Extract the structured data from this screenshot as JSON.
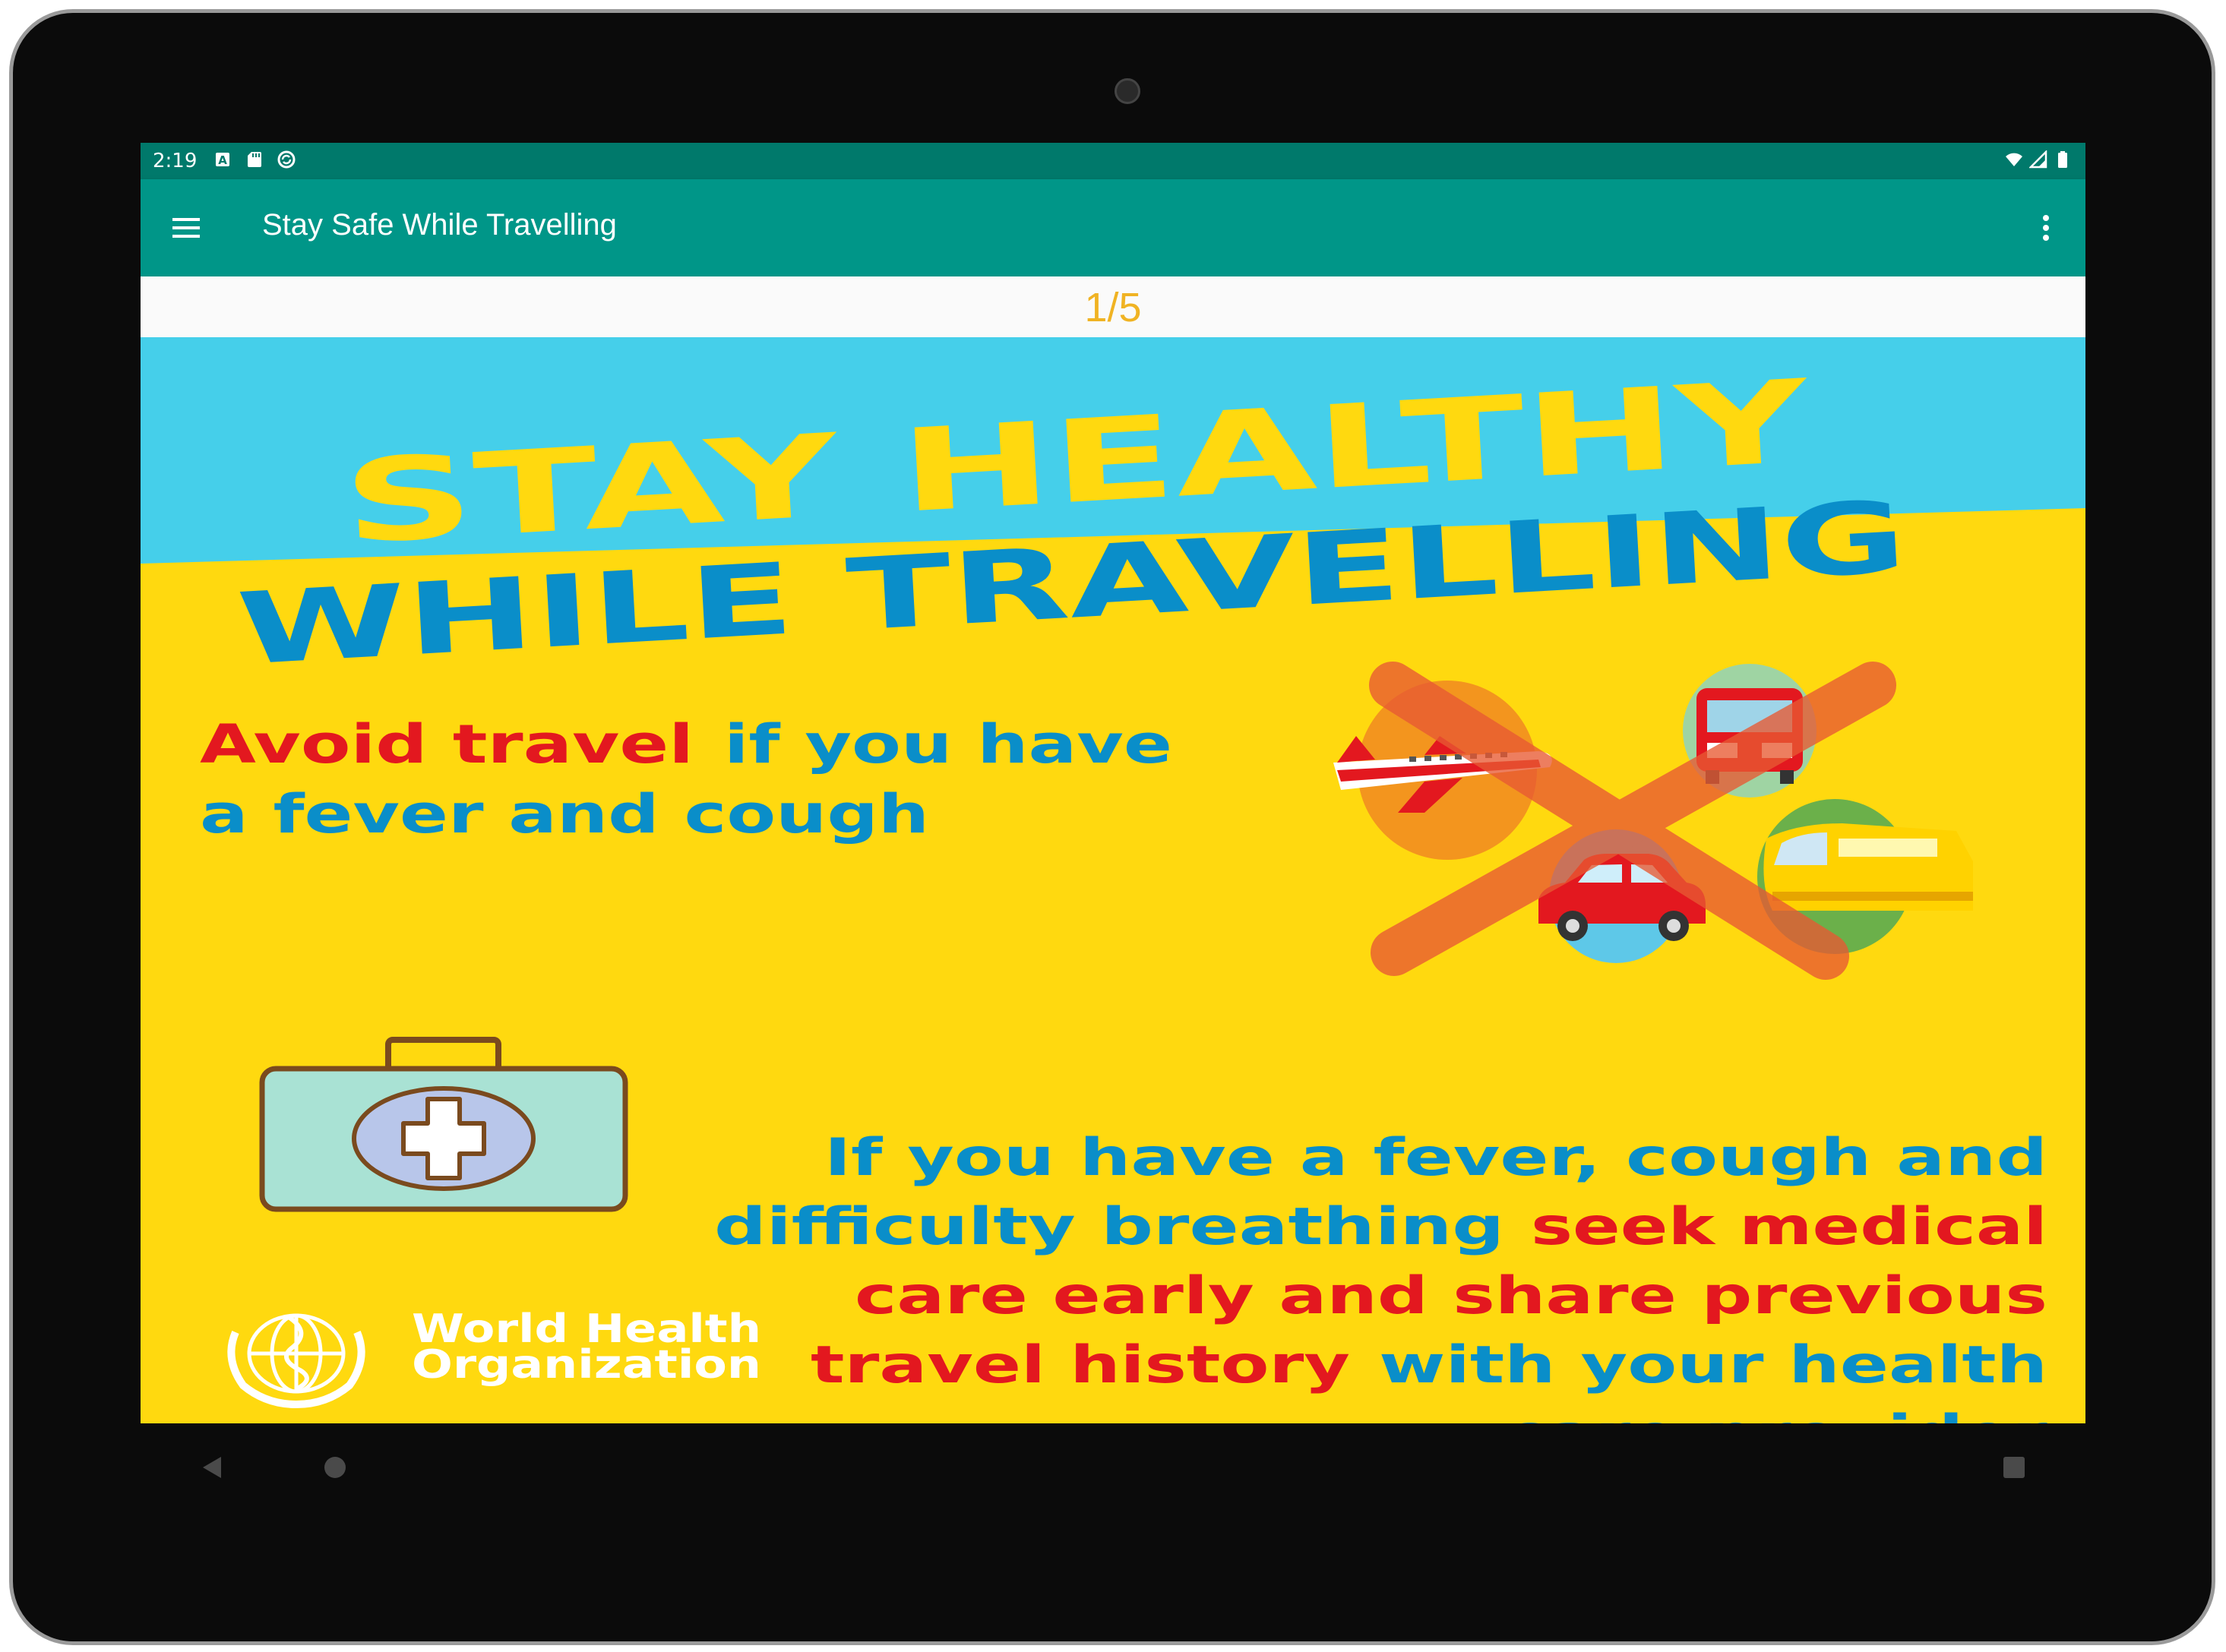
{
  "status_bar": {
    "time": "2:19",
    "left_icons": [
      "a-notification-icon",
      "sd-card-icon",
      "sync-circle-icon"
    ],
    "right_icons": [
      "wifi-icon",
      "cell-signal-icon",
      "battery-icon"
    ]
  },
  "app_bar": {
    "title": "Stay Safe While Travelling",
    "menu_icon": "hamburger-menu-icon",
    "overflow_icon": "more-vert-icon",
    "background": "#009688",
    "status_background": "#00796b"
  },
  "pager": {
    "indicator": "1/5",
    "color": "#f0b323"
  },
  "poster": {
    "headline_1": "STAY HEALTHY",
    "headline_2": "WHILE TRAVELLING",
    "avoid_red": "Avoid travel",
    "avoid_blue_1": "if you have",
    "avoid_blue_2": "a fever and cough",
    "seek_line_1": "If you have a fever, cough and",
    "seek_line_2_blue": "difficulty breathing",
    "seek_line_2_red": "seek medical",
    "seek_line_3": "care early and share previous",
    "seek_line_4_red": "travel history",
    "seek_line_4_blue": "with your health",
    "seek_line_5": "care provider",
    "org_line_1": "World Health",
    "org_line_2": "Organization",
    "colors": {
      "yellow": "#ffd90f",
      "cyan": "#45cfea",
      "blue": "#0a8ec9",
      "red": "#e3181f"
    },
    "icons": [
      "airplane-icon",
      "bus-icon",
      "car-icon",
      "train-icon",
      "forbidden-cross-icon",
      "medical-kit-icon",
      "who-emblem-icon"
    ]
  },
  "nav_bar": {
    "icons": [
      "back-icon",
      "home-icon",
      "recents-icon"
    ]
  }
}
